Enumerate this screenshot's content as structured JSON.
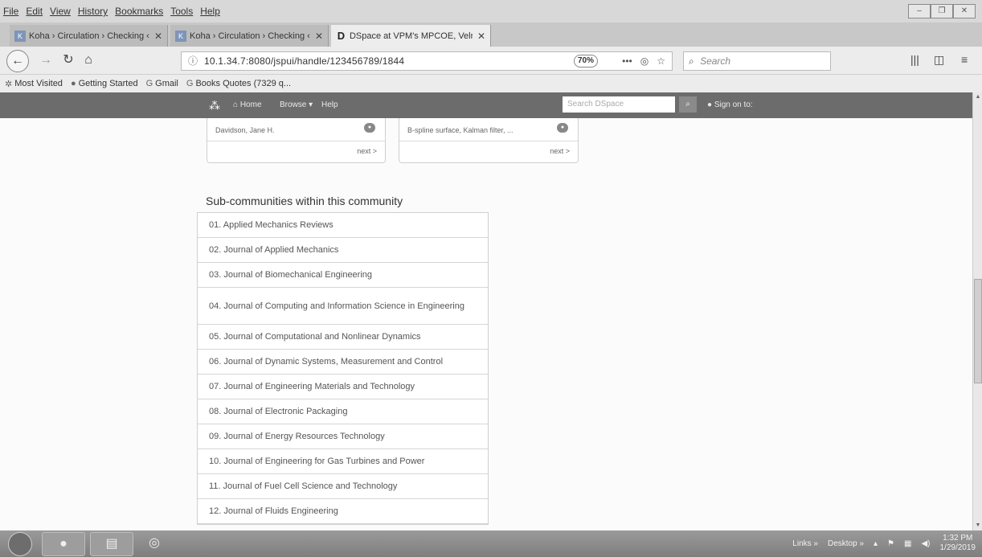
{
  "menubar": {
    "items": [
      "File",
      "Edit",
      "View",
      "History",
      "Bookmarks",
      "Tools",
      "Help"
    ]
  },
  "tabs": [
    {
      "label": "Koha › Circulation › Checking ‹",
      "icon": "koha-icon"
    },
    {
      "label": "Koha › Circulation › Checking ‹",
      "icon": "koha-icon"
    },
    {
      "label": "DSpace at VPM's MPCOE, Velr…",
      "icon": "dspace-icon"
    }
  ],
  "navbar": {
    "url": "10.1.34.7:8080/jspui/handle/123456789/1844",
    "zoom": "70%",
    "search_placeholder": "Search"
  },
  "bookmarks": [
    "Most Visited",
    "Getting Started",
    "Gmail",
    "Books Quotes (7329 q..."
  ],
  "dspace_nav": {
    "home": "Home",
    "browse": "Browse",
    "help": "Help",
    "search_placeholder": "Search DSpace",
    "sign_on": "Sign on to:"
  },
  "cards": [
    {
      "row_text": "Davidson, Jane H.",
      "next": "next >"
    },
    {
      "row_text": "B-spline surface, Kalman filter, ...",
      "next": "next >"
    }
  ],
  "subcommunities": {
    "heading": "Sub-communities within this community",
    "items": [
      "01. Applied Mechanics Reviews",
      "02. Journal of Applied Mechanics",
      "03. Journal of Biomechanical Engineering",
      "04. Journal of Computing and Information Science in Engineering",
      "05. Journal of Computational and Nonlinear Dynamics",
      "06. Journal of Dynamic Systems, Measurement and Control",
      "07. Journal of Engineering Materials and Technology",
      "08. Journal of Electronic Packaging",
      "09. Journal of Energy Resources Technology",
      "10. Journal of Engineering for Gas Turbines and Power",
      "11. Journal of Fuel Cell Science and Technology",
      "12. Journal of Fluids Engineering"
    ]
  },
  "taskbar": {
    "links": "Links",
    "desktop": "Desktop",
    "time": "1:32 PM",
    "date": "1/29/2019"
  }
}
